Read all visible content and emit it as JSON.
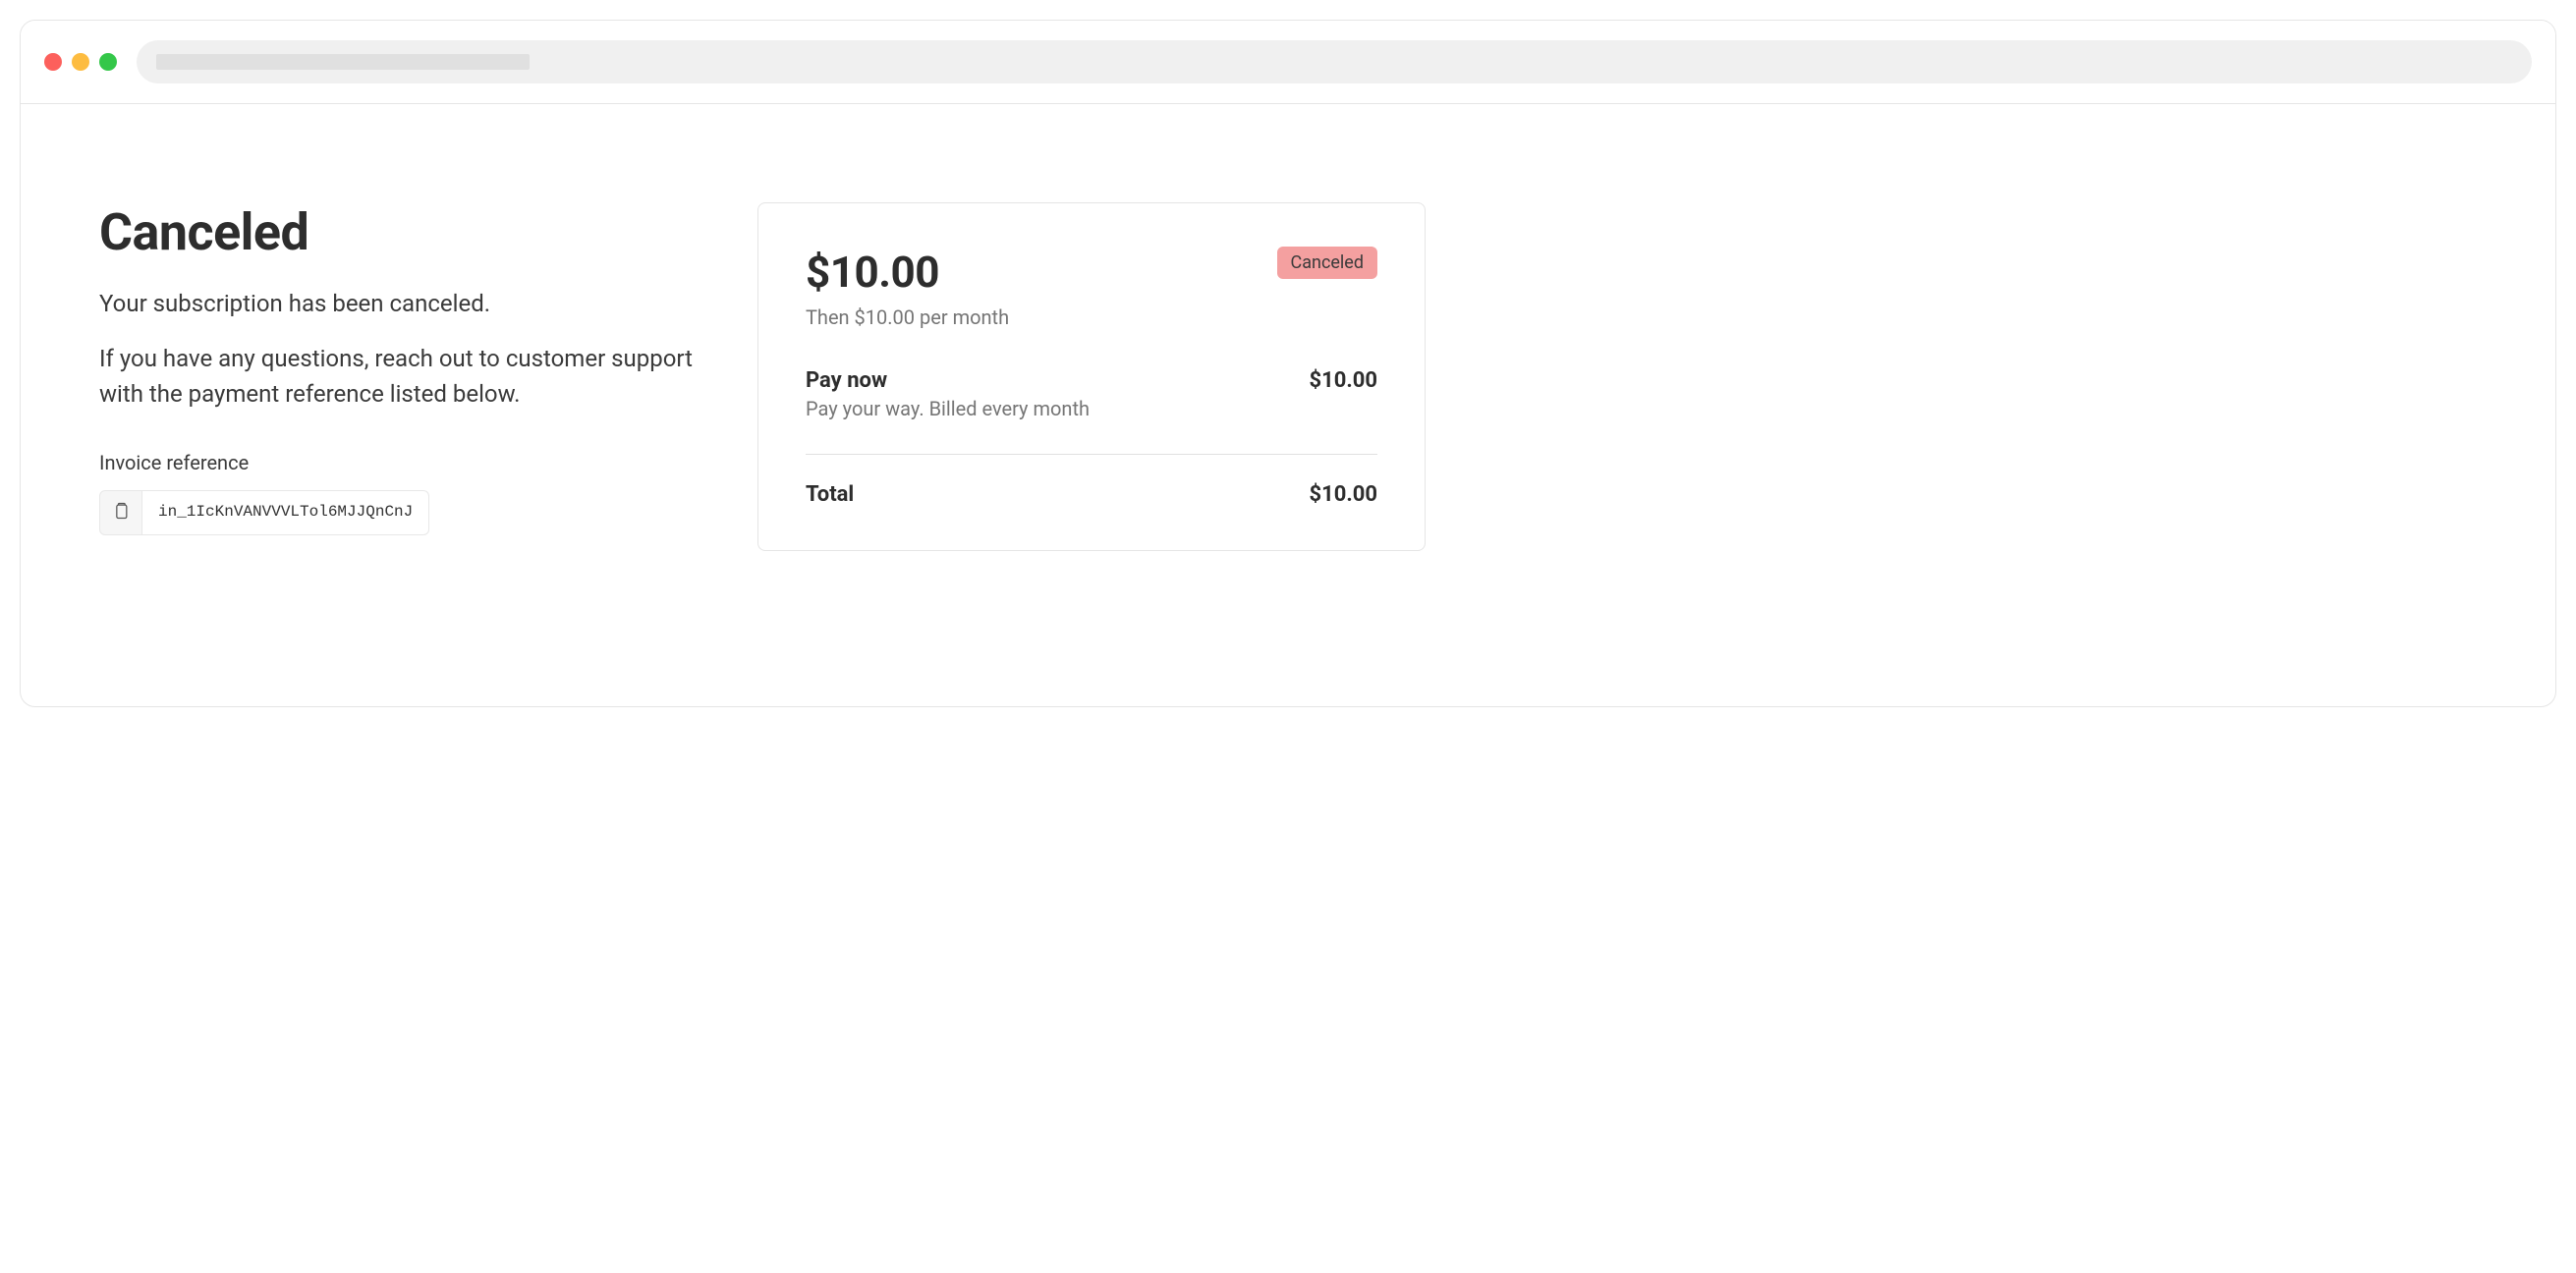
{
  "page": {
    "title": "Canceled",
    "subtitle": "Your subscription has been canceled.",
    "support_text": "If you have any questions, reach out to customer support with the payment reference listed below.",
    "invoice_reference_label": "Invoice reference",
    "invoice_reference_value": "in_1IcKnVANVVVLTol6MJJQnCnJ"
  },
  "summary": {
    "amount": "$10.00",
    "recurrence_text": "Then $10.00 per month",
    "status_badge": "Canceled",
    "line_item": {
      "label": "Pay now",
      "description": "Pay your way. Billed every month",
      "value": "$10.00"
    },
    "total": {
      "label": "Total",
      "value": "$10.00"
    }
  }
}
